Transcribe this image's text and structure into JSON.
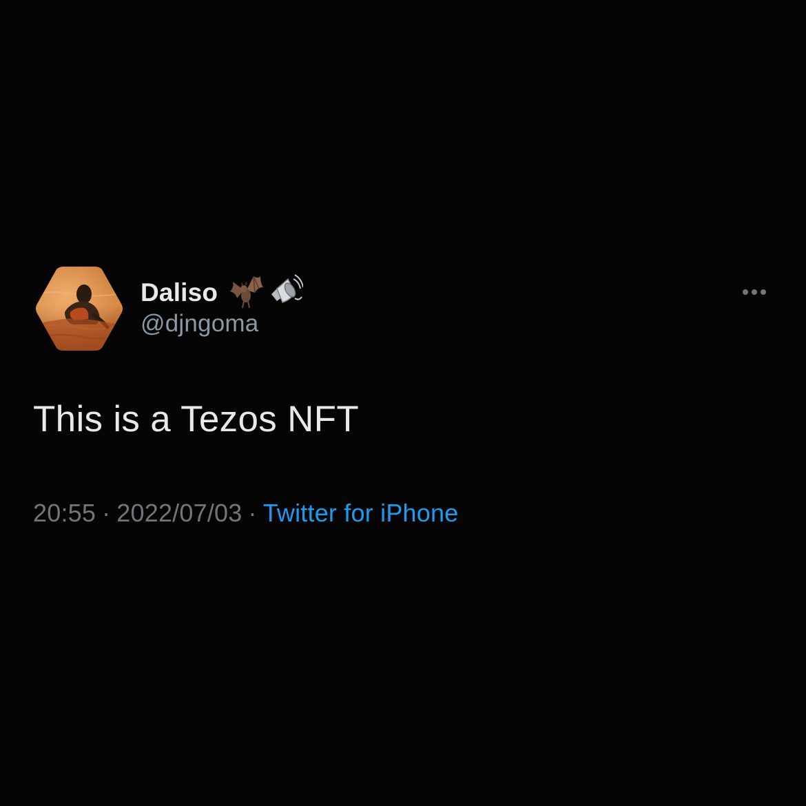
{
  "tweet": {
    "author": {
      "display_name": "Daliso",
      "name_emojis": [
        "bat-emoji-icon",
        "speaker-emoji-icon"
      ],
      "handle": "@djngoma",
      "avatar_icon": "nft-hexagon-avatar"
    },
    "more_icon": "more-dots-icon",
    "text": "This is a Tezos NFT",
    "meta": {
      "time": "20:55",
      "separator": "·",
      "date": "2022/07/03",
      "source": "Twitter for iPhone"
    }
  },
  "colors": {
    "background": "#050505",
    "primary_text": "#e7e9ea",
    "secondary_text": "#71767b",
    "link": "#1d9bf0"
  }
}
